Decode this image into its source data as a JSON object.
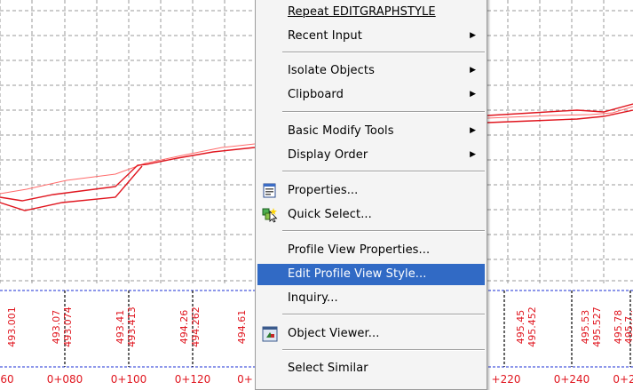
{
  "colors": {
    "grid": "#9a9a9a",
    "profile": "#e0161f",
    "labels": "#e0161f",
    "band_line": "#1b2fd4",
    "highlight": "#316ac5",
    "menu_bg": "#f4f4f4"
  },
  "band": {
    "elevations": [
      {
        "a": "493.001"
      },
      {
        "a": "493.07",
        "b": "493.074"
      },
      {
        "a": "493.41",
        "b": "493.413"
      },
      {
        "a": "494.26",
        "b": "494.262"
      },
      {
        "a": "494.61"
      },
      {
        "a": "495.45",
        "b": "495.452"
      },
      {
        "a": "495.53",
        "b": "495.527"
      },
      {
        "a": "495.78",
        "b": "495.7.."
      }
    ],
    "stations": [
      "60",
      "0+080",
      "0+100",
      "0+120",
      "0+",
      "+220",
      "0+240",
      "0+2"
    ]
  },
  "context_menu": {
    "items": [
      {
        "label": "Repeat EDITGRAPHSTYLE",
        "mnemonic": "R",
        "submenu": false
      },
      {
        "label": "Recent Input",
        "submenu": true
      },
      {
        "label": "Isolate Objects",
        "submenu": true
      },
      {
        "label": "Clipboard",
        "submenu": true
      },
      {
        "label": "Basic Modify Tools",
        "submenu": true
      },
      {
        "label": "Display Order",
        "submenu": true
      },
      {
        "label": "Properties...",
        "icon": "properties-icon",
        "submenu": false
      },
      {
        "label": "Quick Select...",
        "icon": "quick-select-icon",
        "submenu": false
      },
      {
        "label": "Profile View Properties...",
        "submenu": false
      },
      {
        "label": "Edit Profile View Style...",
        "submenu": false,
        "highlighted": true
      },
      {
        "label": "Inquiry...",
        "submenu": false
      },
      {
        "label": "Object Viewer...",
        "icon": "object-viewer-icon",
        "submenu": false
      },
      {
        "label": "Select Similar",
        "submenu": false
      }
    ]
  }
}
